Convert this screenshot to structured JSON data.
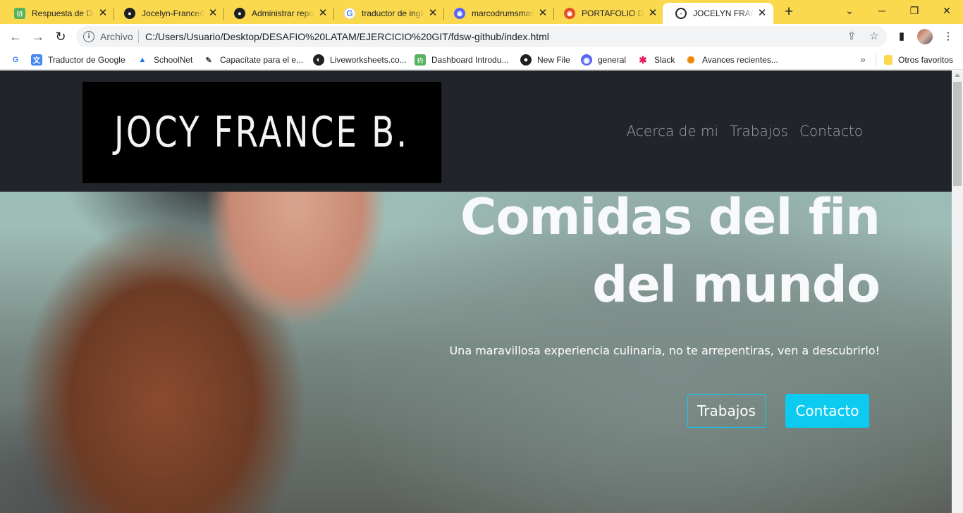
{
  "browser": {
    "tabs": [
      {
        "title": "Respuesta de Desafío",
        "icon": "sheets-icon",
        "active": false
      },
      {
        "title": "Jocelyn-France/DESAFIO",
        "icon": "github-icon",
        "active": false
      },
      {
        "title": "Administrar repositorio",
        "icon": "github-icon",
        "active": false
      },
      {
        "title": "traductor de inglés",
        "icon": "google-icon",
        "active": false
      },
      {
        "title": "marcodrumsmaster",
        "icon": "discord-icon",
        "active": false
      },
      {
        "title": "PORTAFOLIO DE",
        "icon": "portfolio-icon",
        "active": false
      },
      {
        "title": "JOCELYN FRANCE",
        "icon": "page-icon",
        "active": true
      }
    ],
    "new_tab": "+",
    "omnibox": {
      "security_label": "Archivo",
      "url": "C:/Users/Usuario/Desktop/DESAFIO%20LATAM/EJERCICIO%20GIT/fdsw-github/index.html"
    },
    "bookmarks": [
      {
        "label": "Traductor de Google",
        "icon": "google-translate-icon"
      },
      {
        "label": "SchoolNet",
        "icon": "graduation-cap-icon"
      },
      {
        "label": "Capacítate para el e...",
        "icon": "edit-icon"
      },
      {
        "label": "Liveworksheets.co...",
        "icon": "globe-icon"
      },
      {
        "label": "Dashboard Introdu...",
        "icon": "sheets-icon"
      },
      {
        "label": "New File",
        "icon": "github-icon"
      },
      {
        "label": "general",
        "icon": "discord-icon"
      },
      {
        "label": "Slack",
        "icon": "slack-icon"
      },
      {
        "label": "Avances recientes...",
        "icon": "spinner-icon"
      }
    ],
    "bookmarks_more": "»",
    "other_bookmarks": "Otros favoritos"
  },
  "page": {
    "brand": "JOCY FRANCE B.",
    "nav": [
      "Acerca de mi",
      "Trabajos",
      "Contacto"
    ],
    "hero_title_line1": "Comidas del fin",
    "hero_title_line2": "del mundo",
    "hero_subtitle": "Una maravillosa experiencia culinaria, no te arrepentiras, ven a descubrirlo!",
    "btn_primary": "Trabajos",
    "btn_secondary": "Contacto"
  },
  "colors": {
    "tabstrip": "#fbd94f",
    "header": "#212529",
    "accent": "#0dcaf0"
  }
}
